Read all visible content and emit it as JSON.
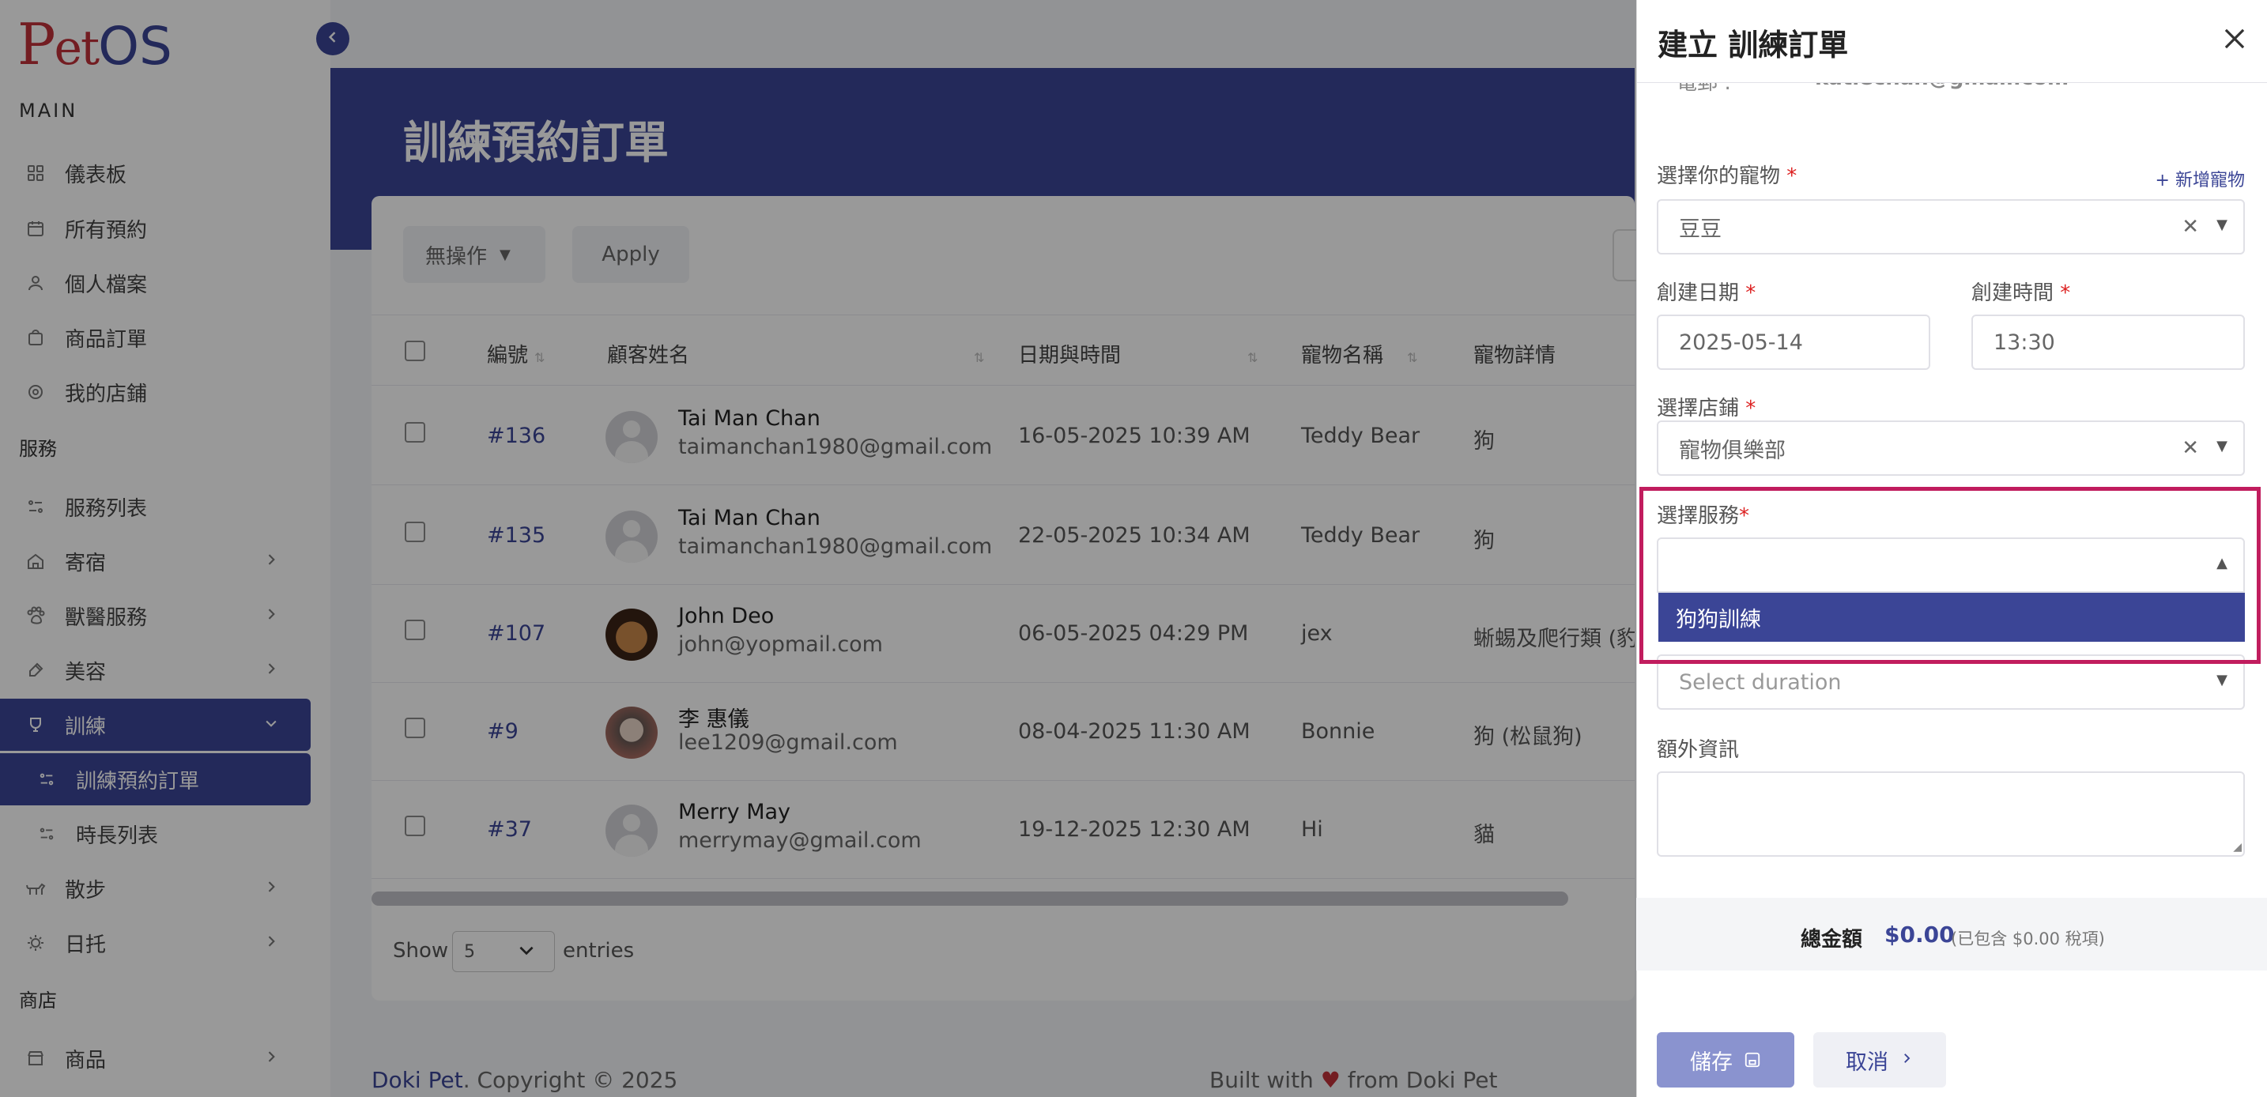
{
  "app": {
    "logo_p": "P",
    "logo_et": "et",
    "logo_os": "OS"
  },
  "sidebar": {
    "section_main": "MAIN",
    "section_services": "服務",
    "section_shop": "商店",
    "items": {
      "dashboard": "儀表板",
      "all_bookings": "所有預約",
      "profile": "個人檔案",
      "product_orders": "商品訂單",
      "my_store": "我的店鋪",
      "service_list": "服務列表",
      "boarding": "寄宿",
      "vet": "獸醫服務",
      "grooming": "美容",
      "training": "訓練",
      "training_orders": "訓練預約訂單",
      "duration_list": "時長列表",
      "walking": "散步",
      "daycare": "日托",
      "products": "商品"
    }
  },
  "page": {
    "title": "訓練預約訂單",
    "bulk_action": "無操作",
    "apply": "Apply"
  },
  "table": {
    "headers": [
      "編號",
      "顧客姓名",
      "日期與時間",
      "寵物名稱",
      "寵物詳情"
    ],
    "rows": [
      {
        "id": "#136",
        "name": "Tai Man Chan",
        "email": "taimanchan1980@gmail.com",
        "date": "16-05-2025 10:39 AM",
        "pet": "Teddy Bear",
        "detail": "狗"
      },
      {
        "id": "#135",
        "name": "Tai Man Chan",
        "email": "taimanchan1980@gmail.com",
        "date": "22-05-2025 10:34 AM",
        "pet": "Teddy Bear",
        "detail": "狗"
      },
      {
        "id": "#107",
        "name": "John Deo",
        "email": "john@yopmail.com",
        "date": "06-05-2025 04:29 PM",
        "pet": "jex",
        "detail": "蜥蜴及爬行類 (豹紋"
      },
      {
        "id": "#9",
        "name": "李 惠儀",
        "email": "lee1209@gmail.com",
        "date": "08-04-2025 11:30 AM",
        "pet": "Bonnie",
        "detail": "狗 (松鼠狗)"
      },
      {
        "id": "#37",
        "name": "Merry May",
        "email": "merrymay@gmail.com",
        "date": "19-12-2025 12:30 AM",
        "pet": "Hi",
        "detail": "貓"
      }
    ],
    "show_label": "Show",
    "page_size": "5",
    "entries_label": "entries"
  },
  "footer": {
    "brand": "Doki Pet",
    "copyright": ". Copyright © 2025",
    "built_with": "Built with",
    "heart": "♥",
    "from": "from Doki Pet"
  },
  "drawer": {
    "title": "建立 訓練訂單",
    "partial_email_label": "電郵 :",
    "partial_email_value": "katiechan@gmail.com",
    "pet_label": "選擇你的寵物",
    "add_pet": "新增寵物",
    "pet_value": "豆豆",
    "date_label": "創建日期",
    "date_value": "2025-05-14",
    "time_label": "創建時間",
    "time_value": "13:30",
    "store_label": "選擇店鋪",
    "store_value": "寵物俱樂部",
    "service_label": "選擇服務",
    "service_option": "狗狗訓練",
    "duration_placeholder": "Select duration",
    "extra_label": "額外資訊",
    "total_label": "總金額",
    "total_amount": "$0.00",
    "tax_note": "(已包含 $0.00 稅項)",
    "save": "儲存",
    "cancel": "取消",
    "required_mark": "*"
  },
  "colors": {
    "primary": "#3b4596",
    "highlight": "#c11d5e",
    "logo_red": "#c0313a"
  }
}
